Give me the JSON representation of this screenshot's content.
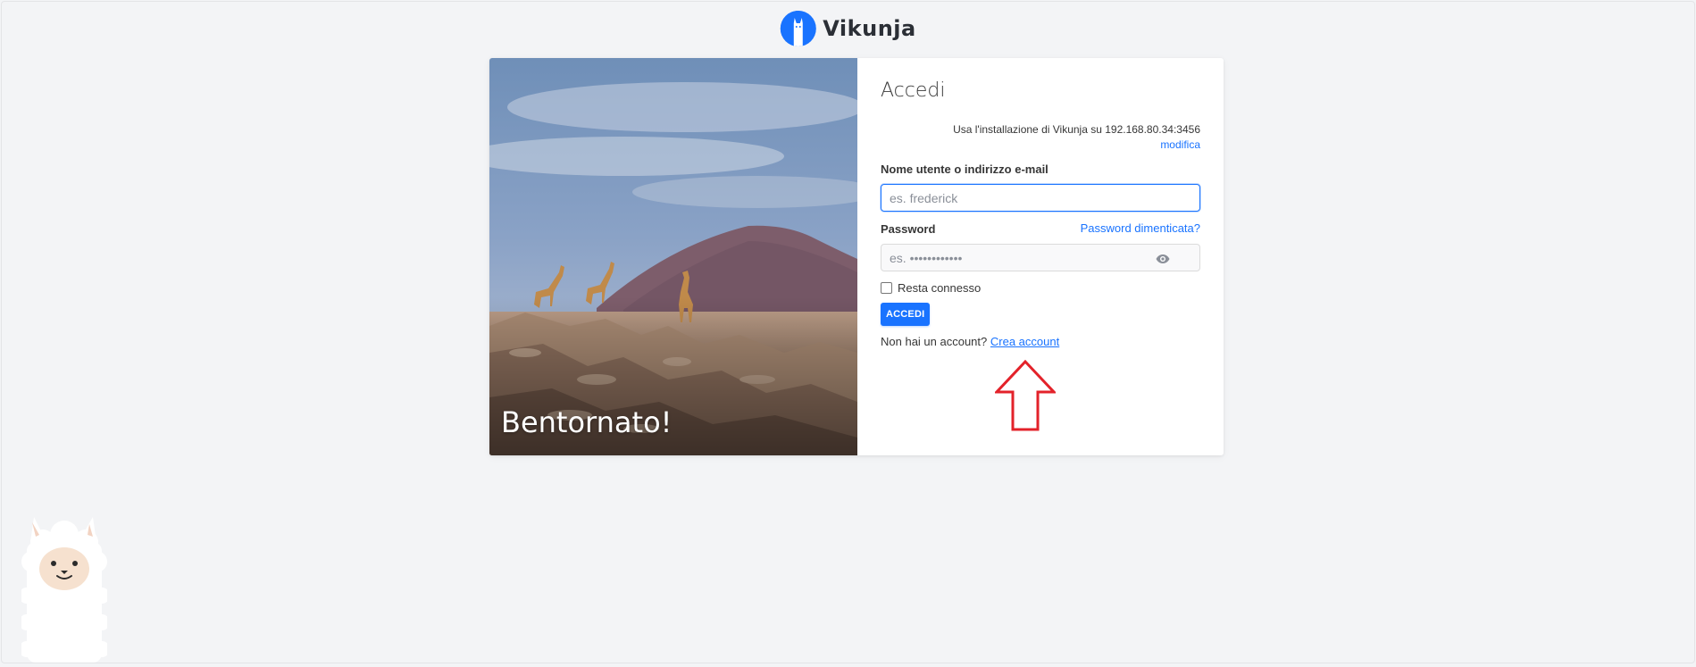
{
  "app": {
    "name": "Vikunja"
  },
  "hero": {
    "title": "Bentornato!"
  },
  "login": {
    "title": "Accedi",
    "server_info": "Usa l'installazione di Vikunja su 192.168.80.34:3456",
    "server_change": "modifica",
    "username_label": "Nome utente o indirizzo e-mail",
    "username_placeholder": "es. frederick",
    "password_label": "Password",
    "password_placeholder": "es. ••••••••••••",
    "forgot_password": "Password dimenticata?",
    "remember_label": "Resta connesso",
    "submit_label": "ACCEDI",
    "register_prompt": "Non hai un account?",
    "register_link": "Crea account"
  },
  "icons": {
    "logo": "vikunja-logo-icon",
    "password_toggle": "eye-icon",
    "annotation": "arrow-up-icon",
    "mascot": "llama-icon"
  },
  "colors": {
    "primary": "#1973ff",
    "background": "#f3f4f6",
    "annotation": "#e3222a"
  }
}
